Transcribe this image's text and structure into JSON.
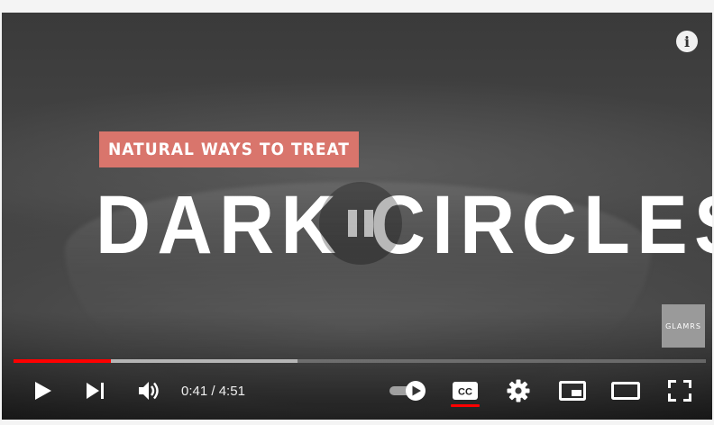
{
  "overlay": {
    "tag_text": "NATURAL WAYS TO TREAT",
    "headline": "DARK CIRCLES",
    "brand_logo": "GLAMRS"
  },
  "player": {
    "current_time": "0:41",
    "separator": " / ",
    "duration": "4:51",
    "played_fraction": 0.14,
    "buffered_fraction": 0.41,
    "autoplay_on": true,
    "captions_on": true
  },
  "icons": {
    "info": "info-icon",
    "play": "play-icon",
    "next": "next-icon",
    "volume": "volume-icon",
    "autoplay": "autoplay-toggle-icon",
    "captions": "captions-icon",
    "settings": "gear-icon",
    "miniplayer": "miniplayer-icon",
    "theater": "theater-mode-icon",
    "fullscreen": "fullscreen-icon"
  },
  "colors": {
    "progress_played": "#ff0000",
    "tag_background": "#d9756c"
  }
}
